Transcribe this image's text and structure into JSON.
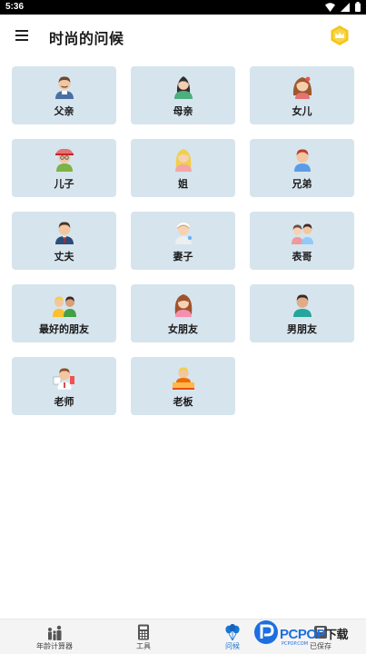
{
  "status_bar": {
    "time": "5:36"
  },
  "app_bar": {
    "title": "时尚的问候"
  },
  "cards": [
    {
      "label": "父亲",
      "icon": "father-avatar-icon"
    },
    {
      "label": "母亲",
      "icon": "mother-avatar-icon"
    },
    {
      "label": "女儿",
      "icon": "daughter-avatar-icon"
    },
    {
      "label": "儿子",
      "icon": "son-avatar-icon"
    },
    {
      "label": "姐",
      "icon": "sister-avatar-icon"
    },
    {
      "label": "兄弟",
      "icon": "brother-avatar-icon"
    },
    {
      "label": "丈夫",
      "icon": "husband-avatar-icon"
    },
    {
      "label": "妻子",
      "icon": "wife-avatar-icon"
    },
    {
      "label": "表哥",
      "icon": "cousins-avatar-icon"
    },
    {
      "label": "最好的朋友",
      "icon": "best-friends-avatar-icon"
    },
    {
      "label": "女朋友",
      "icon": "girlfriend-avatar-icon"
    },
    {
      "label": "男朋友",
      "icon": "boyfriend-avatar-icon"
    },
    {
      "label": "老师",
      "icon": "teacher-avatar-icon"
    },
    {
      "label": "老板",
      "icon": "boss-avatar-icon"
    }
  ],
  "bottom_nav": [
    {
      "label": "年龄计算器",
      "icon": "family-icon",
      "active": false
    },
    {
      "label": "工具",
      "icon": "calculator-icon",
      "active": false
    },
    {
      "label": "问候",
      "icon": "balloons-icon",
      "active": true
    },
    {
      "label": "已保存",
      "icon": "saved-icon",
      "active": false
    }
  ],
  "watermark": {
    "text": "PCPOP",
    "cn": "下载",
    "sub": "PCPOP.COM"
  },
  "colors": {
    "card_bg": "#d6e4ed",
    "active_nav": "#1976d2",
    "premium": "#f5c518"
  }
}
